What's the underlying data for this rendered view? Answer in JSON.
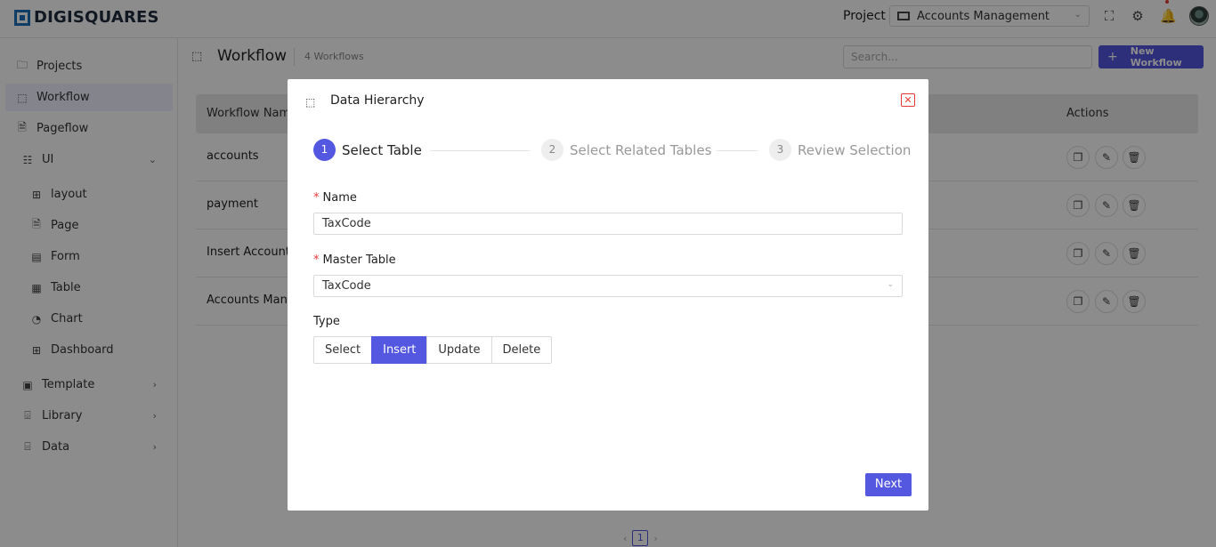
{
  "app": {
    "logo_text": "DIGISQUARES"
  },
  "topbar": {
    "project_label": "Project",
    "project_value": "Accounts Management",
    "icons": [
      "fullscreen-icon",
      "gear-icon",
      "bell-icon",
      "avatar"
    ]
  },
  "sidebar": {
    "items": [
      {
        "label": "Projects",
        "icon": "folder-icon"
      },
      {
        "label": "Workflow",
        "icon": "workflow-icon",
        "active": true
      },
      {
        "label": "Pageflow",
        "icon": "document-icon"
      },
      {
        "label": "UI",
        "icon": "ui-icon",
        "expanded": true
      },
      {
        "label": "layout",
        "icon": "layout-icon"
      },
      {
        "label": "Page",
        "icon": "page-icon"
      },
      {
        "label": "Form",
        "icon": "form-icon"
      },
      {
        "label": "Table",
        "icon": "table-icon"
      },
      {
        "label": "Chart",
        "icon": "chart-icon"
      },
      {
        "label": "Dashboard",
        "icon": "dashboard-icon"
      },
      {
        "label": "Template",
        "icon": "template-icon"
      },
      {
        "label": "Library",
        "icon": "library-icon"
      },
      {
        "label": "Data",
        "icon": "data-icon"
      }
    ]
  },
  "page": {
    "title": "Workflow",
    "count": "4 Workflows",
    "search_placeholder": "Search...",
    "new_button": "New Workflow",
    "table": {
      "col_name": "Workflow Name",
      "col_actions": "Actions",
      "rows": [
        "accounts",
        "payment",
        "Insert Accounts",
        "Accounts Manag"
      ]
    },
    "pagination": {
      "current": "1"
    }
  },
  "modal": {
    "title": "Data Hierarchy",
    "steps": [
      {
        "num": "1",
        "label": "Select Table",
        "active": true
      },
      {
        "num": "2",
        "label": "Select Related Tables",
        "active": false
      },
      {
        "num": "3",
        "label": "Review Selection",
        "active": false
      }
    ],
    "name_label": "Name",
    "name_value": "TaxCode",
    "master_label": "Master Table",
    "master_value": "TaxCode",
    "type_label": "Type",
    "type_options": [
      "Select",
      "Insert",
      "Update",
      "Delete"
    ],
    "type_selected": "Insert",
    "next_button": "Next"
  },
  "colors": {
    "accent": "#5457e0",
    "danger": "#e53935",
    "brand": "#1d6fb8"
  }
}
